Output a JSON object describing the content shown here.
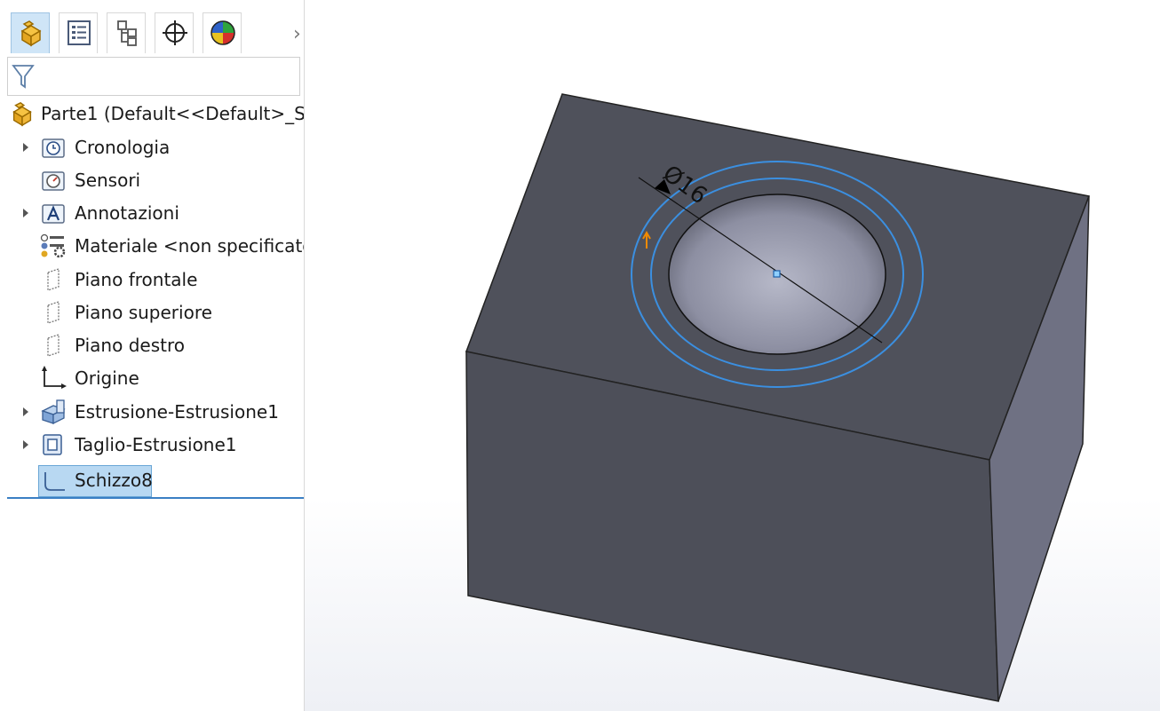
{
  "feature_manager": {
    "tabs": [
      {
        "name": "featuremanager-tab",
        "icon": "part-icon",
        "active": true
      },
      {
        "name": "propertymanager-tab",
        "icon": "property-list-icon"
      },
      {
        "name": "configurationmanager-tab",
        "icon": "configuration-icon"
      },
      {
        "name": "dimxpert-tab",
        "icon": "crosshair-icon"
      },
      {
        "name": "display-manager-tab",
        "icon": "appearance-sphere-icon"
      }
    ],
    "filter_icon": "filter-funnel-icon",
    "tree": {
      "root_label": "Parte1  (Default<<Default>_St",
      "items": [
        {
          "label": "Cronologia",
          "icon": "history-icon",
          "expandable": true
        },
        {
          "label": "Sensori",
          "icon": "sensor-icon",
          "expandable": false
        },
        {
          "label": "Annotazioni",
          "icon": "annotation-icon",
          "expandable": true
        },
        {
          "label": "Materiale <non specificato",
          "icon": "material-icon",
          "expandable": false
        },
        {
          "label": "Piano frontale",
          "icon": "plane-icon",
          "expandable": false
        },
        {
          "label": "Piano superiore",
          "icon": "plane-icon",
          "expandable": false
        },
        {
          "label": "Piano destro",
          "icon": "plane-icon",
          "expandable": false
        },
        {
          "label": "Origine",
          "icon": "origin-icon",
          "expandable": false
        },
        {
          "label": "Estrusione-Estrusione1",
          "icon": "boss-extrude-icon",
          "expandable": true
        },
        {
          "label": "Taglio-Estrusione1",
          "icon": "cut-extrude-icon",
          "expandable": true
        },
        {
          "label": "Schizzo8",
          "icon": "sketch-icon",
          "expandable": false,
          "selected": true
        }
      ]
    }
  },
  "viewport": {
    "dimension_label": "Ø16",
    "colors": {
      "body_face_top": "#4f515b",
      "body_face_front": "#4d4f59",
      "body_face_side": "#6f7183",
      "sketch_blue": "#3b8fe0",
      "accent_selection": "#b8d8f2"
    }
  }
}
